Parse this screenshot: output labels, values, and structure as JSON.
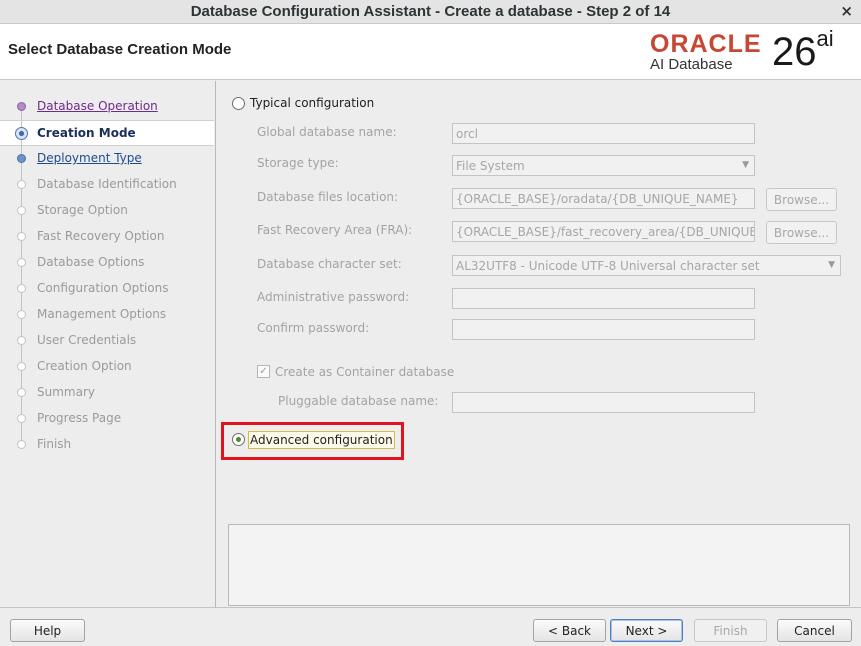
{
  "window": {
    "title": "Database Configuration Assistant - Create a database - Step 2 of 14",
    "close_glyph": "×"
  },
  "header": {
    "step_title": "Select Database Creation Mode",
    "brand": "ORACLE",
    "product": "AI Database",
    "version": "26",
    "version_suffix": "ai"
  },
  "sidebar": {
    "steps": [
      {
        "label": "Database Operation",
        "state": "done"
      },
      {
        "label": "Creation Mode",
        "state": "current"
      },
      {
        "label": "Deployment Type",
        "state": "link"
      },
      {
        "label": "Database Identification",
        "state": "pending"
      },
      {
        "label": "Storage Option",
        "state": "pending"
      },
      {
        "label": "Fast Recovery Option",
        "state": "pending"
      },
      {
        "label": "Database Options",
        "state": "pending"
      },
      {
        "label": "Configuration Options",
        "state": "pending"
      },
      {
        "label": "Management Options",
        "state": "pending"
      },
      {
        "label": "User Credentials",
        "state": "pending"
      },
      {
        "label": "Creation Option",
        "state": "pending"
      },
      {
        "label": "Summary",
        "state": "pending"
      },
      {
        "label": "Progress Page",
        "state": "pending"
      },
      {
        "label": "Finish",
        "state": "pending"
      }
    ]
  },
  "typical": {
    "radio_label": "Typical configuration",
    "global_db_name_label": "Global database name:",
    "global_db_name_value": "orcl",
    "storage_type_label": "Storage type:",
    "storage_type_value": "File System",
    "db_files_location_label": "Database files location:",
    "db_files_location_value": "{ORACLE_BASE}/oradata/{DB_UNIQUE_NAME}",
    "fra_label": "Fast Recovery Area (FRA):",
    "fra_value": "{ORACLE_BASE}/fast_recovery_area/{DB_UNIQUE_NAME}",
    "browse_label": "Browse...",
    "charset_label": "Database character set:",
    "charset_value": "AL32UTF8 - Unicode UTF-8 Universal character set",
    "admin_password_label": "Administrative password:",
    "confirm_password_label": "Confirm password:",
    "container_db_label": "Create as Container database",
    "container_db_checked": true,
    "pdb_name_label": "Pluggable database name:"
  },
  "advanced": {
    "radio_label": "Advanced configuration",
    "selected": true
  },
  "footer": {
    "help": "Help",
    "back": "< Back",
    "next": "Next >",
    "finish": "Finish",
    "cancel": "Cancel"
  }
}
